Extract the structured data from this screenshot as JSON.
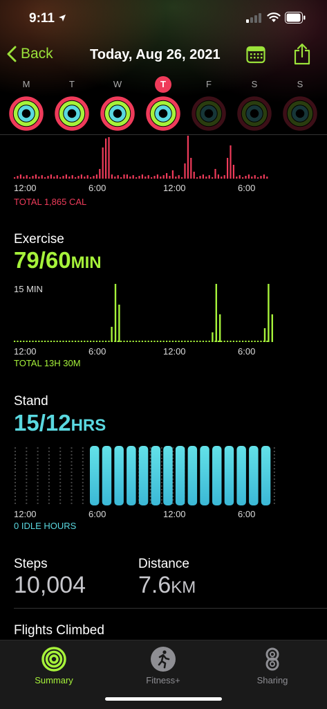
{
  "status": {
    "time": "9:11"
  },
  "nav": {
    "back_label": "Back",
    "title": "Today, Aug 26, 2021"
  },
  "week": [
    {
      "letter": "M",
      "active": false,
      "closed": true
    },
    {
      "letter": "T",
      "active": false,
      "closed": true
    },
    {
      "letter": "W",
      "active": false,
      "closed": true
    },
    {
      "letter": "T",
      "active": true,
      "closed": true
    },
    {
      "letter": "F",
      "active": false,
      "closed": false
    },
    {
      "letter": "S",
      "active": false,
      "closed": false
    },
    {
      "letter": "S",
      "active": false,
      "closed": false
    }
  ],
  "move": {
    "ticks": [
      "12:00",
      "6:00",
      "12:00",
      "6:00"
    ],
    "total": "TOTAL 1,865 CAL",
    "color": "#ef3b5a"
  },
  "exercise": {
    "title": "Exercise",
    "value": "79/60",
    "unit": "MIN",
    "scale_label": "15 MIN",
    "ticks": [
      "12:00",
      "6:00",
      "12:00",
      "6:00"
    ],
    "total": "TOTAL 13H 30M",
    "color": "#a6f23a"
  },
  "stand": {
    "title": "Stand",
    "value": "15/12",
    "unit": "HRS",
    "ticks": [
      "12:00",
      "6:00",
      "12:00",
      "6:00"
    ],
    "total": "0 IDLE HOURS",
    "color": "#5ad8e0"
  },
  "steps": {
    "label": "Steps",
    "value": "10,004"
  },
  "distance": {
    "label": "Distance",
    "value": "7.6",
    "unit": "KM"
  },
  "flights": {
    "label": "Flights Climbed"
  },
  "tabs": [
    {
      "label": "Summary",
      "icon": "activity-rings-icon",
      "active": true
    },
    {
      "label": "Fitness+",
      "icon": "running-figure-icon",
      "active": false
    },
    {
      "label": "Sharing",
      "icon": "sharing-icon",
      "active": false
    }
  ]
}
